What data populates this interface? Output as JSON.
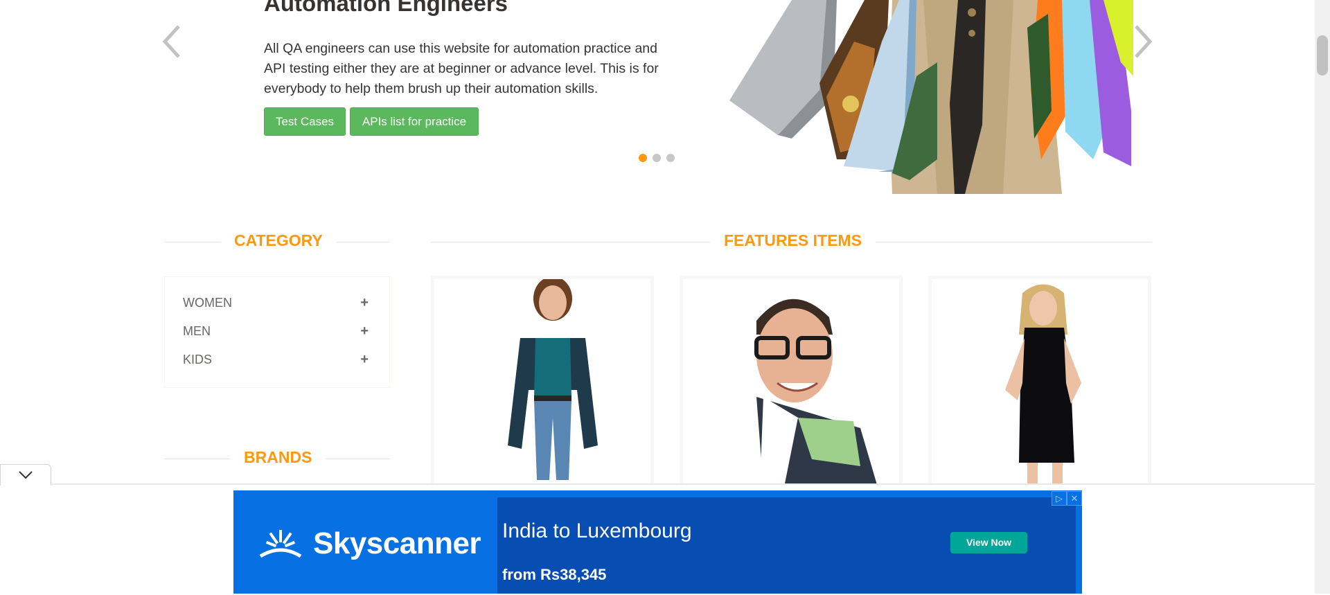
{
  "hero": {
    "title": "Automation Engineers",
    "description": "All QA engineers can use this website for automation practice and API testing either they are at beginner or advance level. This is for everybody to help them brush up their automation skills.",
    "buttons": {
      "test_cases": "Test Cases",
      "apis": "APIs list for practice"
    },
    "indicators": {
      "count": 3,
      "active_index": 0
    }
  },
  "sidebar": {
    "category_title": "CATEGORY",
    "categories": [
      {
        "label": "WOMEN",
        "toggle": "+"
      },
      {
        "label": "MEN",
        "toggle": "+"
      },
      {
        "label": "KIDS",
        "toggle": "+"
      }
    ],
    "brands_title": "BRANDS"
  },
  "features": {
    "title": "FEATURES ITEMS"
  },
  "ad": {
    "brand": "Skyscanner",
    "headline": "India to Luxembourg",
    "price": "from Rs38,345",
    "cta": "View Now"
  },
  "colors": {
    "accent_orange": "#FE980F",
    "button_green": "#5cb85c",
    "ad_blue": "#0770e3",
    "ad_panel_blue": "#084eb2",
    "ad_cta_teal": "#00a698"
  }
}
